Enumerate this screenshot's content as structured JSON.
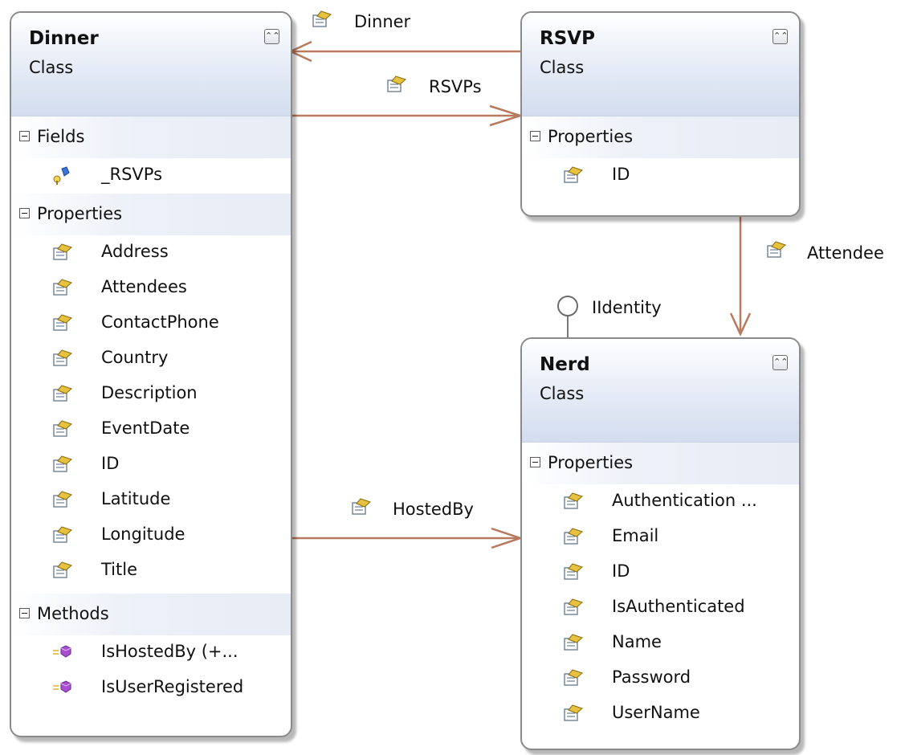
{
  "classes": {
    "dinner": {
      "name": "Dinner",
      "kind": "Class",
      "fields_label": "Fields",
      "fields": [
        "_RSVPs"
      ],
      "properties_label": "Properties",
      "properties": [
        "Address",
        "Attendees",
        "ContactPhone",
        "Country",
        "Description",
        "EventDate",
        "ID",
        "Latitude",
        "Longitude",
        "Title"
      ],
      "methods_label": "Methods",
      "methods": [
        "IsHostedBy (+...",
        "IsUserRegistered"
      ]
    },
    "rsvp": {
      "name": "RSVP",
      "kind": "Class",
      "properties_label": "Properties",
      "properties": [
        "ID"
      ]
    },
    "nerd": {
      "name": "Nerd",
      "kind": "Class",
      "properties_label": "Properties",
      "properties": [
        "Authentication ...",
        "Email",
        "ID",
        "IsAuthenticated",
        "Name",
        "Password",
        "UserName"
      ]
    }
  },
  "associations": {
    "dinner": "Dinner",
    "rsvps": "RSVPs",
    "attendee": "Attendee",
    "hosted_by": "HostedBy"
  },
  "interface_label": "IIdentity",
  "icons": {
    "property": "property-icon",
    "field": "private-field-icon",
    "method": "method-icon",
    "collapse": "collapse-chevron-icon",
    "section_toggle": "minus-toggle-icon",
    "lollipop": "interface-lollipop-icon"
  },
  "colors": {
    "connector": "#b87a5e",
    "header_bg": "#d3ddef",
    "border": "#8a8a8a"
  }
}
